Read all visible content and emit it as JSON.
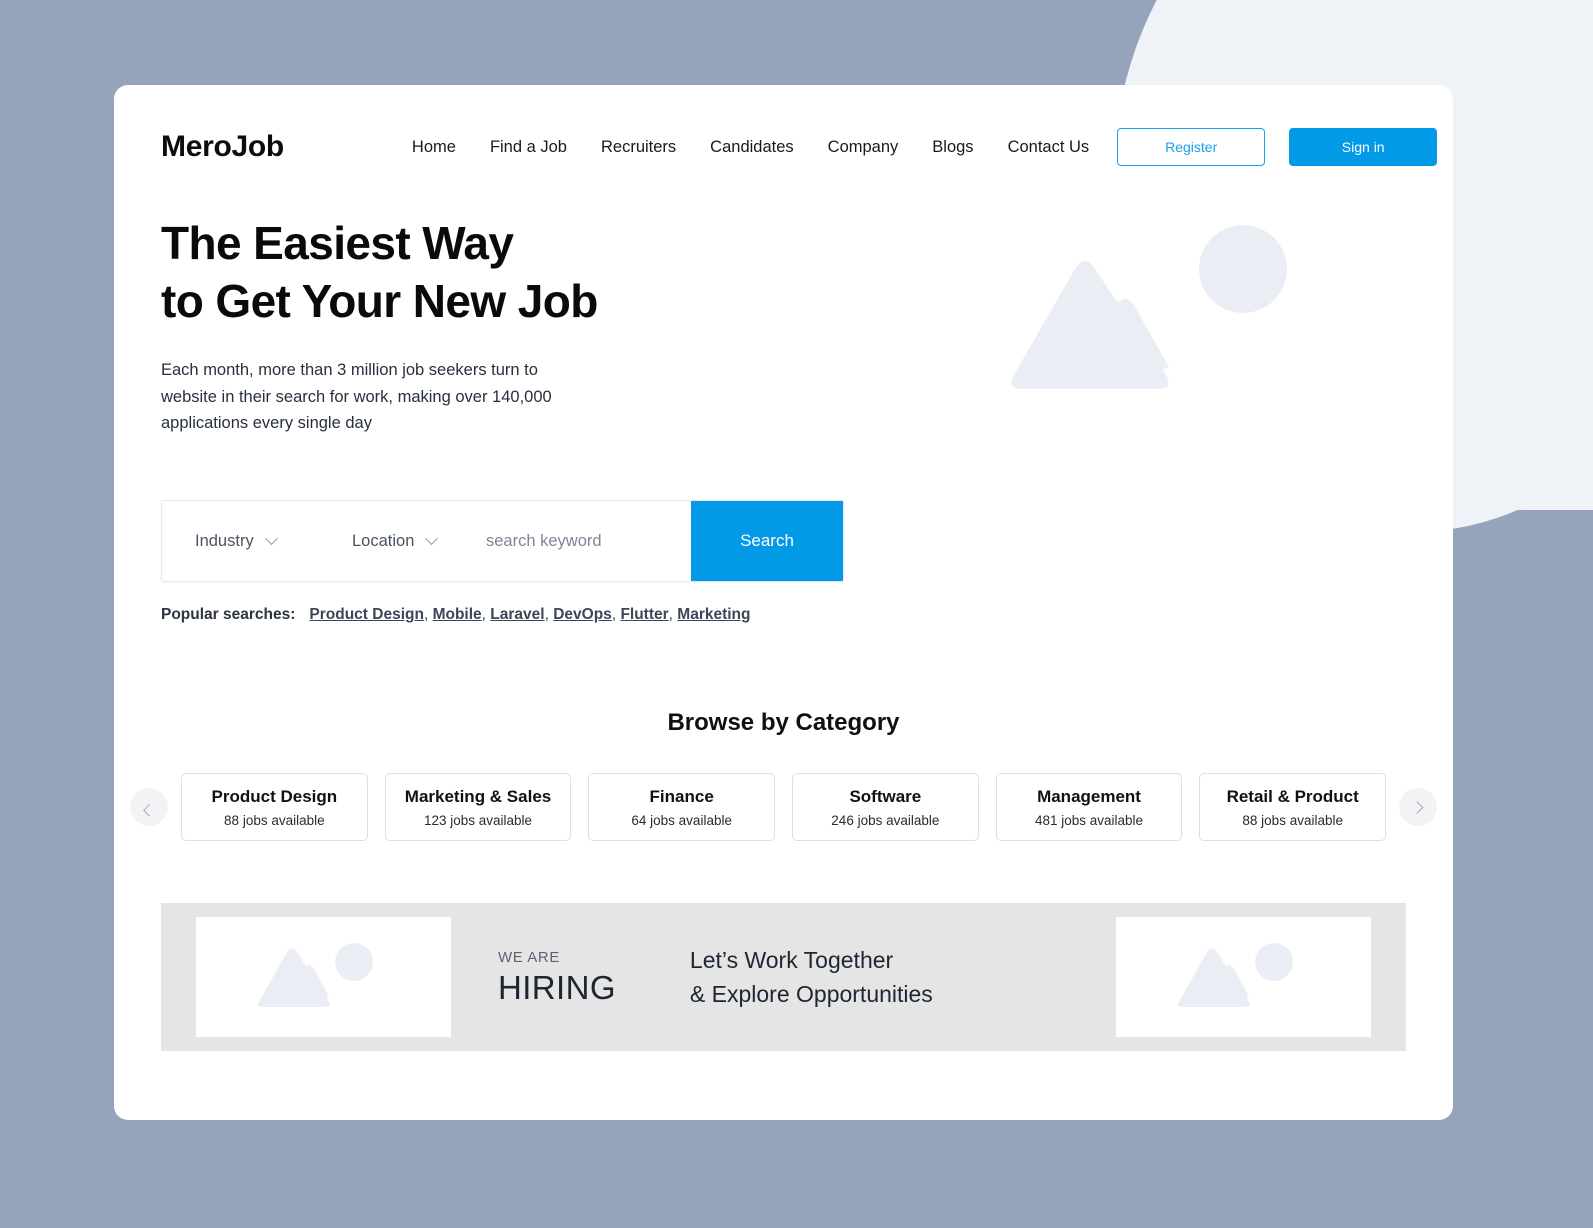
{
  "brand": {
    "logo": "MeroJob",
    "accent": "#029ae6",
    "background": "#95a3bb"
  },
  "nav": {
    "items": [
      {
        "label": "Home"
      },
      {
        "label": "Find a Job"
      },
      {
        "label": "Recruiters"
      },
      {
        "label": "Candidates"
      },
      {
        "label": "Company"
      },
      {
        "label": "Blogs"
      },
      {
        "label": "Contact Us"
      }
    ],
    "register_label": "Register",
    "signin_label": "Sign in"
  },
  "hero": {
    "title_line1": "The Easiest Way",
    "title_line2": "to Get Your New Job",
    "subtitle": "Each month, more than 3 million job seekers turn to website in their search for work, making over 140,000 applications every single day",
    "illustration_icon": "image-placeholder-icon"
  },
  "search": {
    "industry_label": "Industry",
    "location_label": "Location",
    "keyword_placeholder": "search keyword",
    "keyword_value": "",
    "button_label": "Search"
  },
  "popular": {
    "label": "Popular searches:",
    "links": [
      "Product Design",
      "Mobile",
      "Laravel",
      "DevOps",
      "Flutter",
      "Marketing"
    ]
  },
  "categories": {
    "section_title": "Browse by Category",
    "prev_icon": "chevron-left-icon",
    "next_icon": "chevron-right-icon",
    "items": [
      {
        "name": "Product Design",
        "count": "88 jobs available"
      },
      {
        "name": "Marketing & Sales",
        "count": "123 jobs available"
      },
      {
        "name": "Finance",
        "count": "64 jobs available"
      },
      {
        "name": "Software",
        "count": "246 jobs available"
      },
      {
        "name": "Management",
        "count": "481 jobs available"
      },
      {
        "name": "Retail & Product",
        "count": "88 jobs available"
      }
    ]
  },
  "banner": {
    "we_are": "WE ARE",
    "hiring": "HIRING",
    "tagline_line1": "Let’s Work Together",
    "tagline_line2": "& Explore Opportunities",
    "left_image_icon": "image-placeholder-icon",
    "right_image_icon": "image-placeholder-icon"
  }
}
